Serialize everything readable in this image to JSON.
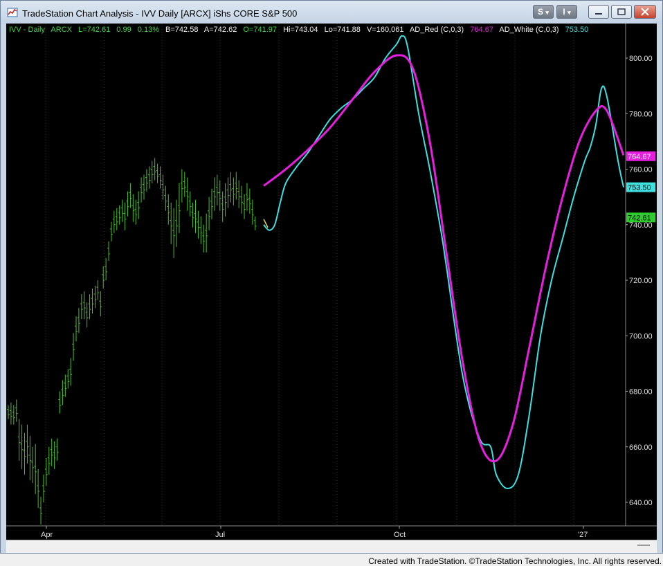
{
  "window": {
    "title": "TradeStation Chart Analysis - IVV Daily [ARCX] iShs CORE S&P 500",
    "buttons": {
      "s_label": "S",
      "s_arrow": "▾",
      "i_label": "I",
      "i_arrow": "▾"
    }
  },
  "status": {
    "symbol": "IVV - Daily",
    "exchange": "ARCX",
    "last": "L=742.61",
    "change": "0.99",
    "change_pct": "0.13%",
    "bid": "B=742.58",
    "ask": "A=742.62",
    "open": "O=741.97",
    "high": "Hi=743.04",
    "low": "Lo=741.88",
    "volume": "V=160,061",
    "ind1_name": "AD_Red (C,0,3)",
    "ind1_value": "764.67",
    "ind2_name": "AD_White (C,0,3)",
    "ind2_value": "753.50"
  },
  "price_axis": {
    "ticks": [
      "800.00",
      "780.00",
      "760.00",
      "740.00",
      "720.00",
      "700.00",
      "680.00",
      "660.00",
      "640.00"
    ],
    "badges": {
      "red": {
        "label": "764.67",
        "value": 764.67
      },
      "white": {
        "label": "753.50",
        "value": 753.5
      },
      "last": {
        "label": "742.61",
        "value": 742.61
      }
    }
  },
  "time_axis": {
    "labels": [
      "Apr",
      "Jul",
      "Oct",
      "'27"
    ]
  },
  "colors": {
    "background": "#000000",
    "bars": "#4cc02a",
    "status_text": "#45d245",
    "ad_red": "#e81ee0",
    "ad_white": "#3fe0e0",
    "last_badge": "#2ecc2e",
    "grid": "#3a3a3a"
  },
  "chart_data": {
    "type": "line",
    "ylim": [
      630,
      810
    ],
    "x_labels": [
      "Apr",
      "Jul",
      "Oct",
      "'27"
    ],
    "series": [
      {
        "name": "AD_Red (C,0,3)",
        "points": [
          [
            0,
            754
          ],
          [
            4,
            760
          ],
          [
            8,
            767
          ],
          [
            12,
            775
          ],
          [
            16,
            785
          ],
          [
            20,
            795
          ],
          [
            24,
            801
          ],
          [
            27,
            796
          ],
          [
            30,
            770
          ],
          [
            33,
            730
          ],
          [
            36,
            690
          ],
          [
            39,
            662
          ],
          [
            42,
            655
          ],
          [
            45,
            668
          ],
          [
            48,
            696
          ],
          [
            51,
            725
          ],
          [
            54,
            750
          ],
          [
            57,
            770
          ],
          [
            60,
            781
          ],
          [
            62,
            781
          ],
          [
            65,
            765
          ]
        ]
      },
      {
        "name": "AD_White (C,0,3)",
        "points": [
          [
            0,
            740
          ],
          [
            1,
            738
          ],
          [
            2,
            740
          ],
          [
            3,
            748
          ],
          [
            4,
            755
          ],
          [
            6,
            761
          ],
          [
            8,
            766
          ],
          [
            10,
            772
          ],
          [
            12,
            778
          ],
          [
            14,
            782
          ],
          [
            16,
            785
          ],
          [
            18,
            789
          ],
          [
            20,
            793
          ],
          [
            22,
            800
          ],
          [
            24,
            805
          ],
          [
            25,
            808
          ],
          [
            26,
            804
          ],
          [
            28,
            780
          ],
          [
            30,
            760
          ],
          [
            32,
            738
          ],
          [
            33,
            725
          ],
          [
            36,
            685
          ],
          [
            39,
            663
          ],
          [
            41,
            660
          ],
          [
            42,
            650
          ],
          [
            44,
            645
          ],
          [
            46,
            650
          ],
          [
            48,
            672
          ],
          [
            50,
            700
          ],
          [
            52,
            720
          ],
          [
            54,
            735
          ],
          [
            56,
            750
          ],
          [
            58,
            763
          ],
          [
            59,
            768
          ],
          [
            60,
            776
          ],
          [
            61,
            789
          ],
          [
            62,
            786
          ],
          [
            64,
            763
          ],
          [
            65,
            753.5
          ]
        ]
      },
      {
        "name": "IVV - Daily",
        "type": "ohlc",
        "bars": [
          [
            0,
            675,
            670
          ],
          [
            1,
            676,
            668
          ],
          [
            2,
            675,
            668
          ],
          [
            3,
            677,
            669
          ],
          [
            4,
            670,
            655
          ],
          [
            5,
            668,
            652
          ],
          [
            6,
            665,
            650
          ],
          [
            7,
            668,
            654
          ],
          [
            8,
            664,
            648
          ],
          [
            9,
            660,
            647
          ],
          [
            10,
            661,
            643
          ],
          [
            11,
            652,
            638
          ],
          [
            12,
            642,
            632
          ],
          [
            13,
            650,
            640
          ],
          [
            14,
            656,
            646
          ],
          [
            15,
            660,
            650
          ],
          [
            16,
            663,
            653
          ],
          [
            17,
            662,
            652
          ],
          [
            18,
            663,
            655
          ],
          [
            19,
            680,
            672
          ],
          [
            20,
            684,
            675
          ],
          [
            21,
            686,
            678
          ],
          [
            22,
            688,
            681
          ],
          [
            23,
            692,
            682
          ],
          [
            24,
            701,
            691
          ],
          [
            25,
            707,
            698
          ],
          [
            26,
            710,
            701
          ],
          [
            27,
            715,
            706
          ],
          [
            28,
            716,
            706
          ],
          [
            29,
            712,
            703
          ],
          [
            30,
            715,
            706
          ],
          [
            31,
            717,
            708
          ],
          [
            32,
            718,
            710
          ],
          [
            33,
            720,
            713
          ],
          [
            34,
            716,
            707
          ],
          [
            35,
            725,
            717
          ],
          [
            36,
            728,
            720
          ],
          [
            37,
            734,
            727
          ],
          [
            38,
            741,
            734
          ],
          [
            39,
            745,
            737
          ],
          [
            40,
            746,
            738
          ],
          [
            41,
            747,
            740
          ],
          [
            42,
            749,
            741
          ],
          [
            43,
            748,
            738
          ],
          [
            44,
            752,
            743
          ],
          [
            45,
            755,
            746
          ],
          [
            46,
            751,
            741
          ],
          [
            47,
            749,
            740
          ],
          [
            48,
            752,
            742
          ],
          [
            49,
            757,
            748
          ],
          [
            50,
            758,
            749
          ],
          [
            51,
            760,
            752
          ],
          [
            52,
            761,
            753
          ],
          [
            53,
            763,
            755
          ],
          [
            54,
            764,
            756
          ],
          [
            55,
            762,
            755
          ],
          [
            56,
            761,
            753
          ],
          [
            57,
            758,
            749
          ],
          [
            58,
            754,
            745
          ],
          [
            59,
            751,
            740
          ],
          [
            60,
            748,
            733
          ],
          [
            61,
            746,
            728
          ],
          [
            62,
            749,
            732
          ],
          [
            63,
            755,
            737
          ],
          [
            64,
            760,
            748
          ],
          [
            65,
            759,
            750
          ],
          [
            66,
            757,
            745
          ],
          [
            67,
            752,
            743
          ],
          [
            68,
            748,
            739
          ],
          [
            69,
            749,
            737
          ],
          [
            70,
            745,
            735
          ],
          [
            71,
            743,
            733
          ],
          [
            72,
            740,
            730
          ],
          [
            73,
            744,
            730
          ],
          [
            74,
            750,
            738
          ],
          [
            75,
            753,
            742
          ],
          [
            76,
            757,
            745
          ],
          [
            77,
            758,
            747
          ],
          [
            78,
            756,
            745
          ],
          [
            79,
            752,
            741
          ],
          [
            80,
            755,
            743
          ],
          [
            81,
            757,
            746
          ],
          [
            82,
            759,
            748
          ],
          [
            83,
            757,
            747
          ],
          [
            84,
            759,
            749
          ],
          [
            85,
            756,
            746
          ],
          [
            86,
            754,
            744
          ],
          [
            87,
            751,
            742
          ],
          [
            88,
            755,
            745
          ],
          [
            89,
            753,
            744
          ],
          [
            90,
            749,
            740
          ],
          [
            91,
            743,
            738
          ]
        ]
      }
    ]
  }
}
